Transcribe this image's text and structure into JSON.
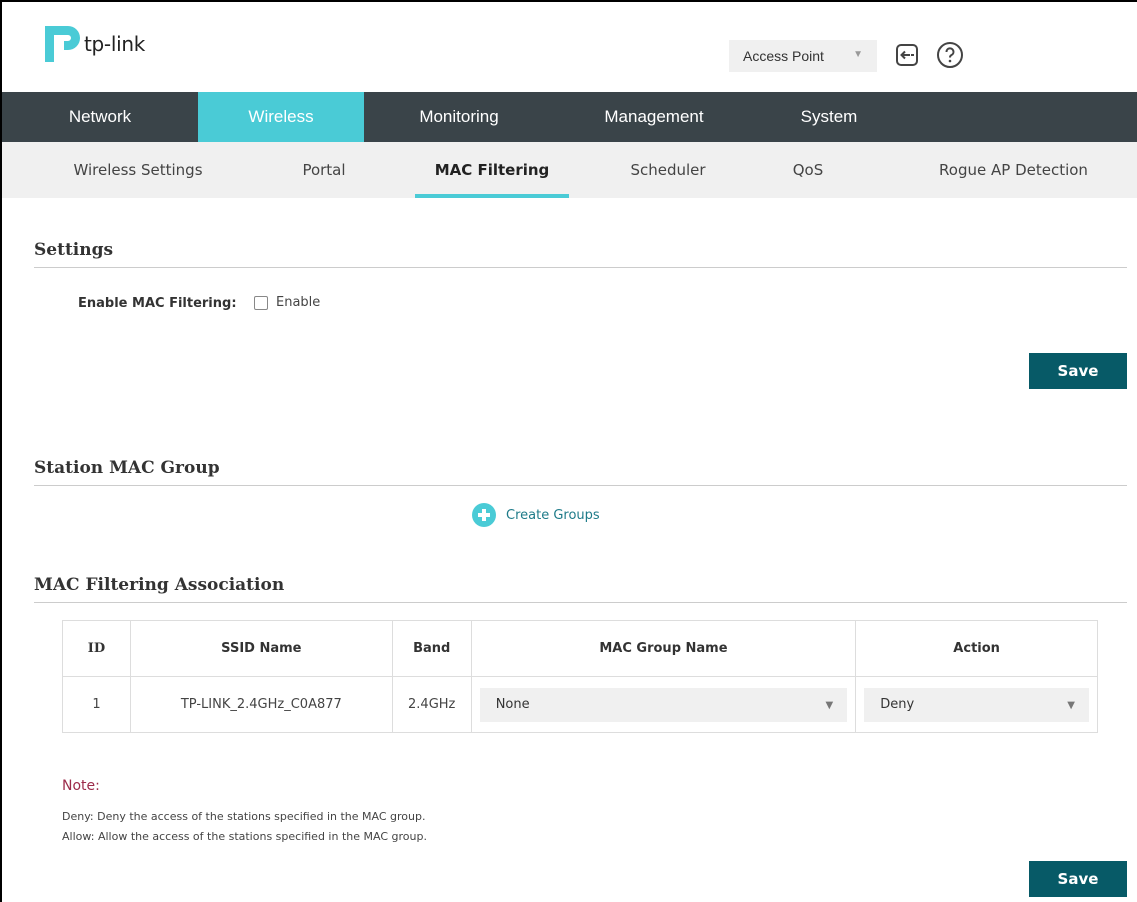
{
  "header": {
    "logo_text": "tp-link",
    "mode": "Access Point",
    "brand_color": "#4acbd6",
    "nav_bg": "#3a4449"
  },
  "main_nav": [
    {
      "label": "Network",
      "active": false
    },
    {
      "label": "Wireless",
      "active": true
    },
    {
      "label": "Monitoring",
      "active": false
    },
    {
      "label": "Management",
      "active": false
    },
    {
      "label": "System",
      "active": false
    }
  ],
  "sub_nav": [
    {
      "label": "Wireless Settings",
      "active": false
    },
    {
      "label": "Portal",
      "active": false
    },
    {
      "label": "MAC Filtering",
      "active": true
    },
    {
      "label": "Scheduler",
      "active": false
    },
    {
      "label": "QoS",
      "active": false
    },
    {
      "label": "Rogue AP Detection",
      "active": false
    }
  ],
  "settings": {
    "title": "Settings",
    "enable_label": "Enable MAC Filtering:",
    "enable_checkbox_label": "Enable",
    "enabled": false,
    "save_label": "Save"
  },
  "station_group": {
    "title": "Station MAC Group",
    "create_label": "Create Groups"
  },
  "association": {
    "title": "MAC Filtering Association",
    "columns": [
      "ID",
      "SSID Name",
      "Band",
      "MAC Group Name",
      "Action"
    ],
    "rows": [
      {
        "id": "1",
        "ssid": "TP-LINK_2.4GHz_C0A877",
        "band": "2.4GHz",
        "mac_group": "None",
        "action": "Deny"
      }
    ]
  },
  "note": {
    "title": "Note:",
    "lines": [
      "Deny: Deny the access of the stations specified in the MAC group.",
      "Allow: Allow the access of the stations specified in the MAC group."
    ],
    "save_label": "Save"
  }
}
